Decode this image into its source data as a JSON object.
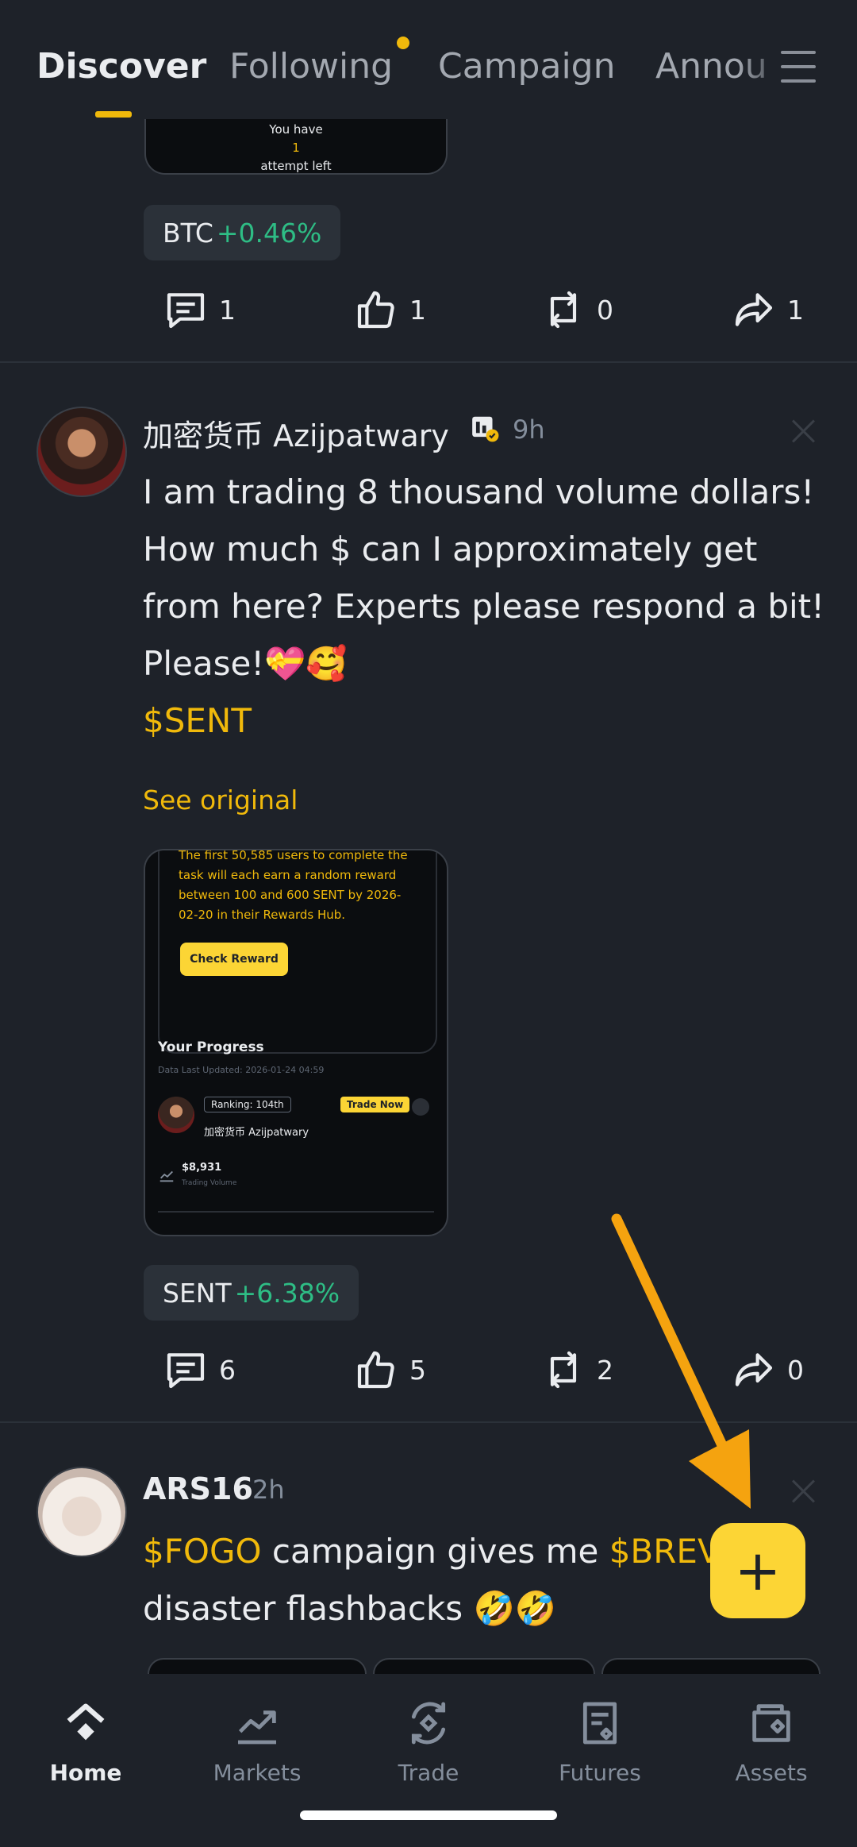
{
  "tabs": [
    {
      "label": "Discover"
    },
    {
      "label": "Following"
    },
    {
      "label": "Campaign"
    },
    {
      "label": "Annou"
    }
  ],
  "post0": {
    "image_text": {
      "line1": "You have",
      "line2": "1",
      "line3": "attempt left"
    },
    "ticker": {
      "symbol": "BTC",
      "change": "+0.46%"
    },
    "actions": {
      "comments": "1",
      "likes": "1",
      "reposts": "0",
      "shares": "1"
    }
  },
  "post1": {
    "author": "加密货币 Azijpatwary",
    "time": "9h",
    "text": "I am trading 8 thousand volume dollars! How much $ can I approximately get from here? Experts please respond a bit! Please!💝🥰",
    "cashtag": "$SENT",
    "see_original": "See original",
    "image": {
      "body": "The first 50,585 users to complete the task will each earn a random reward between 100 and 600 SENT by 2026-02-20 in their Rewards Hub.",
      "check_reward": "Check Reward",
      "progress_title": "Your Progress",
      "updated": "Data Last Updated: 2026-01-24 04:59",
      "ranking": "Ranking: 104th",
      "trade_now": "Trade Now",
      "user": "加密货币 Azijpatwary",
      "volume": "$8,931",
      "volume_label": "Trading Volume"
    },
    "ticker": {
      "symbol": "SENT",
      "change": "+6.38%"
    },
    "actions": {
      "comments": "6",
      "likes": "5",
      "reposts": "2",
      "shares": "0"
    }
  },
  "post2": {
    "author": "ARS16",
    "time": "2h",
    "cashtag1": "$FOGO",
    "text_mid": " campaign gives me ",
    "cashtag2": "$BREV",
    "text_end": "disaster flashbacks 🤣🤣"
  },
  "fab": {
    "label": "+"
  },
  "bottom_nav": [
    {
      "label": "Home"
    },
    {
      "label": "Markets"
    },
    {
      "label": "Trade"
    },
    {
      "label": "Futures"
    },
    {
      "label": "Assets"
    }
  ],
  "colors": {
    "accent": "#f0b90b",
    "positive": "#2ebd85",
    "background": "#1e2229",
    "arrow": "#f5a30f"
  }
}
